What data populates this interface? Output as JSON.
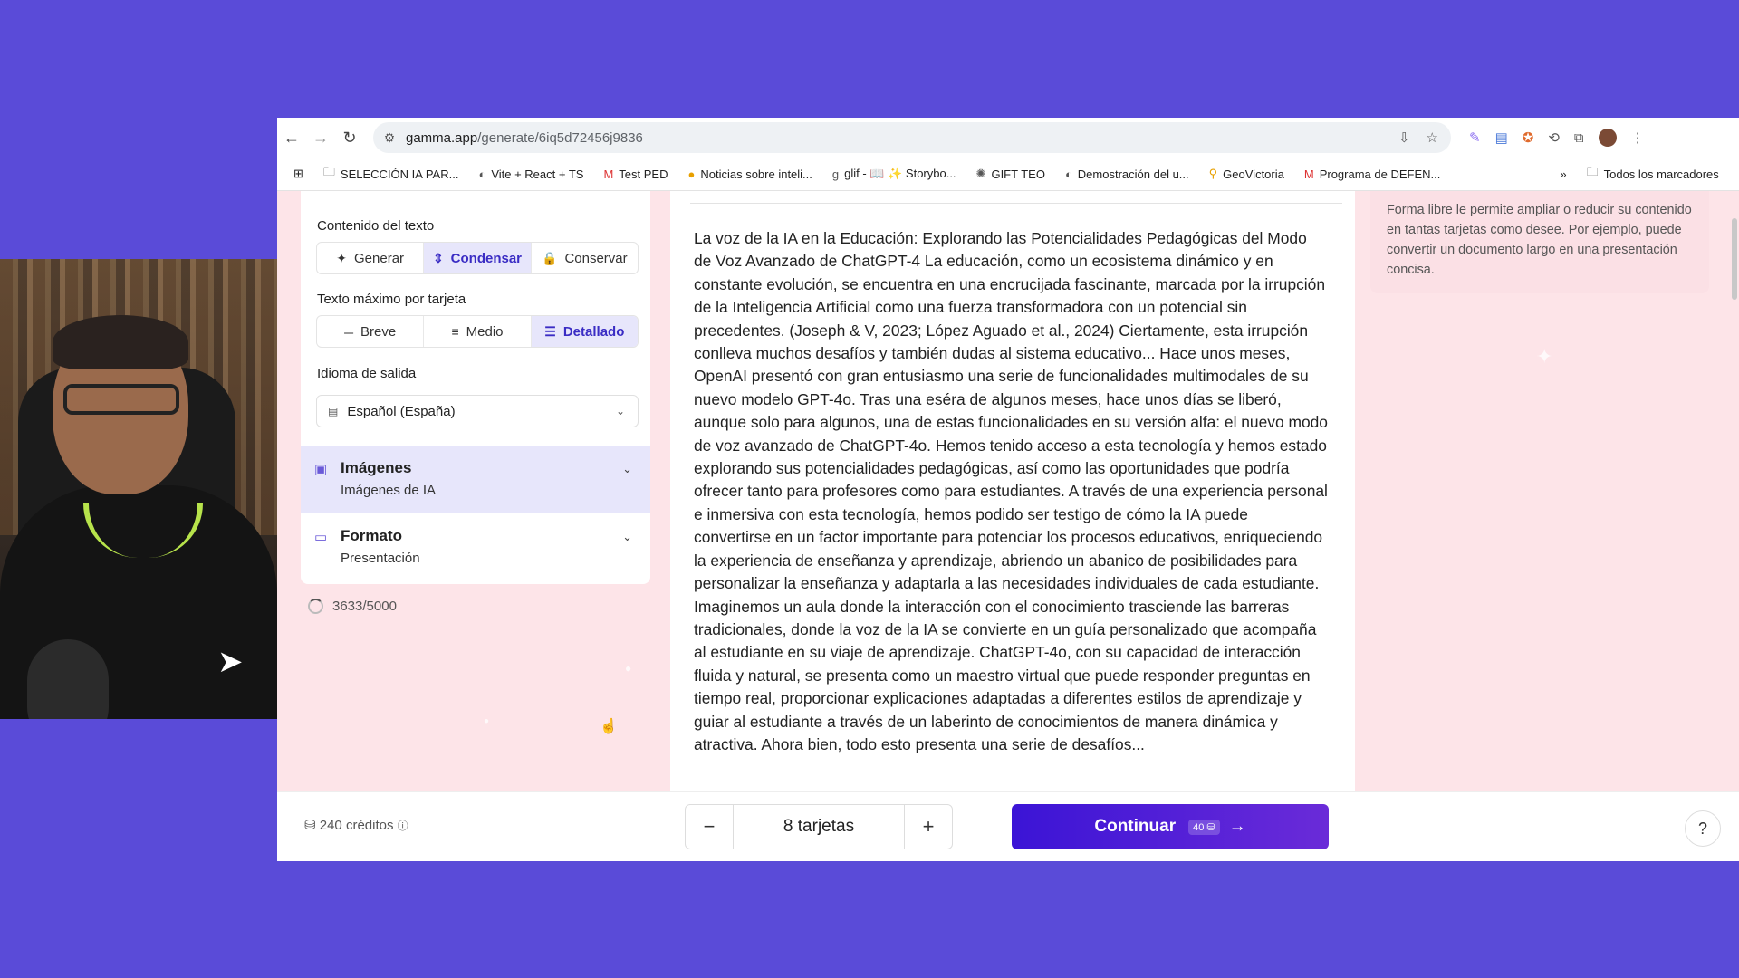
{
  "browser": {
    "url_host": "gamma.app",
    "url_path": "/generate/6iq5d72456j9836",
    "bookmarks": [
      {
        "icon": "folder-icon",
        "label": "SELECCIÓN IA PAR..."
      },
      {
        "icon": "globe-icon",
        "label": "Vite + React + TS"
      },
      {
        "icon": "gmail-icon",
        "label": "Test PED"
      },
      {
        "icon": "news-icon",
        "label": "Noticias sobre inteli..."
      },
      {
        "icon": "glif-icon",
        "label": "glif - 📖 ✨ Storybo..."
      },
      {
        "icon": "openai-icon",
        "label": "GIFT TEO"
      },
      {
        "icon": "globe-icon",
        "label": "Demostración del u..."
      },
      {
        "icon": "pin-icon",
        "label": "GeoVictoria"
      },
      {
        "icon": "gmail-icon",
        "label": "Programa de DEFEN..."
      }
    ],
    "all_bookmarks": "Todos los marcadores"
  },
  "settings": {
    "text_content_label": "Contenido del texto",
    "text_content_options": [
      {
        "icon": "✦",
        "label": "Generar"
      },
      {
        "icon": "⇕",
        "label": "Condensar"
      },
      {
        "icon": "🔒",
        "label": "Conservar"
      }
    ],
    "max_text_label": "Texto máximo por tarjeta",
    "max_text_options": [
      {
        "icon": "═",
        "label": "Breve"
      },
      {
        "icon": "≡",
        "label": "Medio"
      },
      {
        "icon": "☰",
        "label": "Detallado"
      }
    ],
    "language_label": "Idioma de salida",
    "language_value": "Español (España)",
    "images_title": "Imágenes",
    "images_sub": "Imágenes de IA",
    "format_title": "Formato",
    "format_sub": "Presentación",
    "char_count": "3633/5000"
  },
  "document": {
    "text": "La voz de la IA en la Educación: Explorando las Potencialidades Pedagógicas del Modo de Voz Avanzado de ChatGPT-4 La educación, como un ecosistema dinámico y en constante evolución, se encuentra en una encrucijada fascinante, marcada por la irrupción de la Inteligencia Artificial como una fuerza transformadora con un potencial sin precedentes. (Joseph & V, 2023; López Aguado et al., 2024) Ciertamente, esta irrupción conlleva muchos desafíos y también dudas al sistema educativo... Hace unos meses, OpenAI presentó con gran entusiasmo una serie de funcionalidades multimodales de su nuevo modelo GPT-4o. Tras una eséra de algunos meses, hace unos días se liberó, aunque solo para algunos, una de estas funcionalidades en su versión alfa: el nuevo modo de voz avanzado de ChatGPT-4o. Hemos tenido acceso a esta tecnología y hemos estado explorando sus potencialidades pedagógicas, así como las oportunidades que podría ofrecer tanto para profesores como para estudiantes. A través de una experiencia personal e inmersiva con esta tecnología, hemos podido ser testigo de cómo la IA puede convertirse en un factor importante para potenciar los procesos educativos, enriqueciendo la experiencia de enseñanza y aprendizaje, abriendo un abanico de posibilidades para personalizar la enseñanza y adaptarla a las necesidades individuales de cada estudiante. Imaginemos un aula donde la interacción con el conocimiento trasciende las barreras tradicionales, donde la voz de la IA se convierte en un guía personalizado que acompaña al estudiante en su viaje de aprendizaje. ChatGPT-4o, con su capacidad de interacción fluida y natural, se presenta como un maestro virtual que puede responder preguntas en tiempo real, proporcionar explicaciones adaptadas a diferentes estilos de aprendizaje y guiar al estudiante a través de un laberinto de conocimientos de manera dinámica y atractiva. Ahora bien, todo esto presenta una serie de desafíos..."
  },
  "tip": {
    "text": "Forma libre le permite ampliar o reducir su contenido en tantas tarjetas como desee. Por ejemplo, puede convertir un documento largo en una presentación concisa."
  },
  "footer": {
    "credits": "240 créditos",
    "cards": "8 tarjetas",
    "continue_label": "Continuar",
    "continue_cost": "40",
    "help": "?"
  },
  "colors": {
    "accent": "#3b14d6",
    "background": "#5a4bd8",
    "panel": "#fde4e8"
  }
}
